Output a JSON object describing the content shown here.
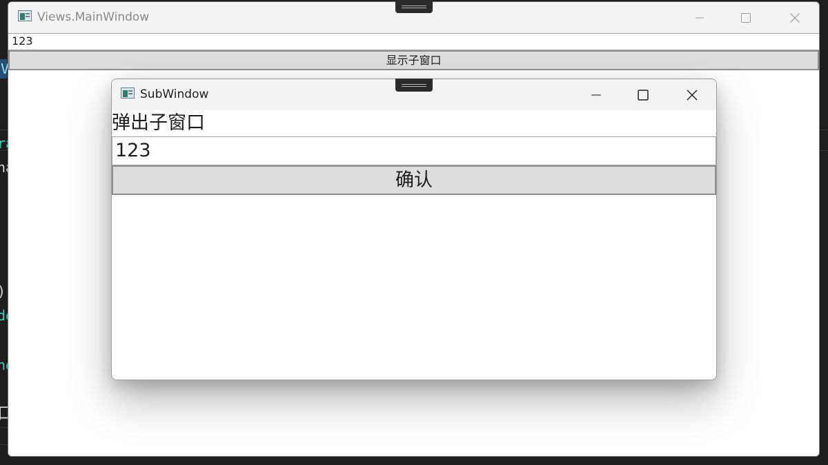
{
  "background": {
    "fragments": [
      {
        "text": "V",
        "color": "#9cdcfe"
      },
      {
        "text": "ra",
        "color": "#4ec9b0"
      },
      {
        "text": "na",
        "color": "#d4d4d4"
      },
      {
        "text": ")",
        "color": "#d4d4d4"
      },
      {
        "text": "de",
        "color": "#4ec9b0"
      },
      {
        "text": "ne",
        "color": "#4ec9b0"
      },
      {
        "text": "口",
        "color": "#d4d4d4"
      }
    ],
    "colors": {
      "editor_bg": "#1e1e1e",
      "selection": "#264f78"
    }
  },
  "main_window": {
    "title": "Views.MainWindow",
    "icon": "app-window-icon",
    "textbox_value": "123",
    "button_label": "显示子窗口",
    "caption_icons": [
      "minimize-icon",
      "maximize-icon",
      "close-icon"
    ]
  },
  "sub_window": {
    "title": "SubWindow",
    "icon": "app-window-icon",
    "label": "弹出子窗口",
    "textbox_value": "123",
    "button_label": "确认",
    "caption_icons": [
      "minimize-icon",
      "maximize-icon",
      "close-icon"
    ]
  }
}
